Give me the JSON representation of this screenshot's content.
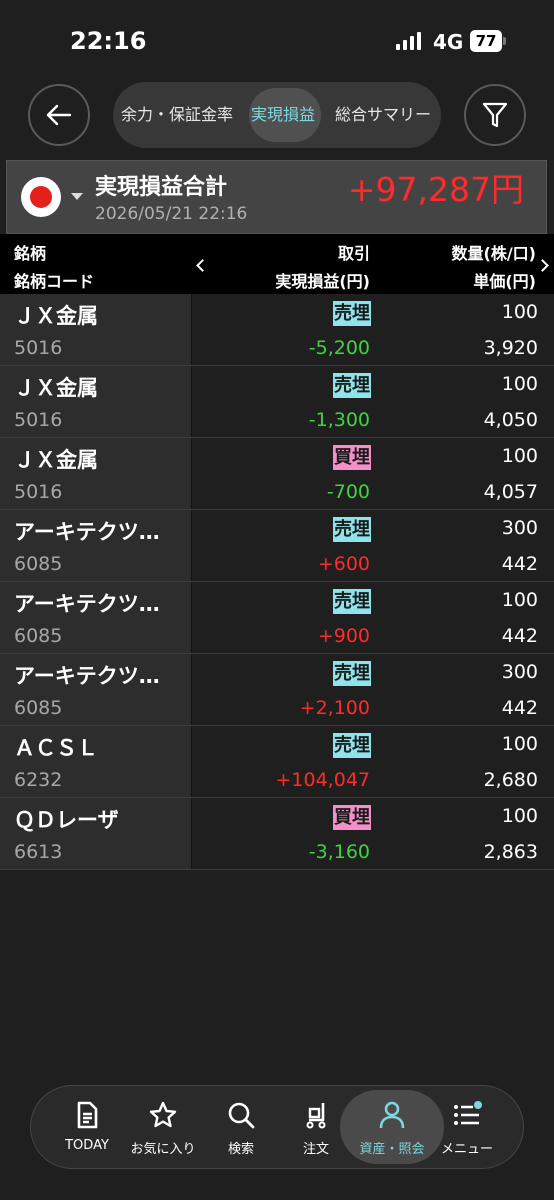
{
  "status_bar": {
    "time": "22:16",
    "network": "4G",
    "battery": "77"
  },
  "header": {
    "tabs": [
      {
        "label": "余力・保証金率",
        "active": false
      },
      {
        "label": "実現損益",
        "active": true
      },
      {
        "label": "総合サマリー",
        "active": false
      }
    ]
  },
  "summary": {
    "title": "実現損益合計",
    "datetime": "2026/05/21 22:16",
    "total": "+97,287円"
  },
  "columns": {
    "name": "銘柄",
    "code": "銘柄コード",
    "trade": "取引",
    "pl": "実現損益(円)",
    "qty": "数量(株/口)",
    "price": "単価(円)"
  },
  "colors": {
    "profit": "#ff2a2a",
    "loss": "#3fd43f",
    "sell_badge": "#8fe3ea",
    "buy_badge": "#f48fc9",
    "accent": "#7fd6de"
  },
  "rows": [
    {
      "name": "ＪＸ金属",
      "code": "5016",
      "trade": "売埋",
      "trade_type": "sell",
      "pl": "-5,200",
      "qty": "100",
      "price": "3,920"
    },
    {
      "name": "ＪＸ金属",
      "code": "5016",
      "trade": "売埋",
      "trade_type": "sell",
      "pl": "-1,300",
      "qty": "100",
      "price": "4,050"
    },
    {
      "name": "ＪＸ金属",
      "code": "5016",
      "trade": "買埋",
      "trade_type": "buy",
      "pl": "-700",
      "qty": "100",
      "price": "4,057"
    },
    {
      "name": "アーキテクツ…",
      "code": "6085",
      "trade": "売埋",
      "trade_type": "sell",
      "pl": "+600",
      "qty": "300",
      "price": "442"
    },
    {
      "name": "アーキテクツ…",
      "code": "6085",
      "trade": "売埋",
      "trade_type": "sell",
      "pl": "+900",
      "qty": "100",
      "price": "442"
    },
    {
      "name": "アーキテクツ…",
      "code": "6085",
      "trade": "売埋",
      "trade_type": "sell",
      "pl": "+2,100",
      "qty": "300",
      "price": "442"
    },
    {
      "name": "ＡＣＳＬ",
      "code": "6232",
      "trade": "売埋",
      "trade_type": "sell",
      "pl": "+104,047",
      "qty": "100",
      "price": "2,680"
    },
    {
      "name": "ＱＤレーザ",
      "code": "6613",
      "trade": "買埋",
      "trade_type": "buy",
      "pl": "-3,160",
      "qty": "100",
      "price": "2,863"
    }
  ],
  "bottom_nav": [
    {
      "label": "TODAY",
      "icon": "document-icon",
      "active": false
    },
    {
      "label": "お気に入り",
      "icon": "star-icon",
      "active": false
    },
    {
      "label": "検索",
      "icon": "search-icon",
      "active": false
    },
    {
      "label": "注文",
      "icon": "cart-icon",
      "active": false
    },
    {
      "label": "資産・照会",
      "icon": "person-icon",
      "active": true
    },
    {
      "label": "メニュー",
      "icon": "menu-icon",
      "active": false
    }
  ]
}
